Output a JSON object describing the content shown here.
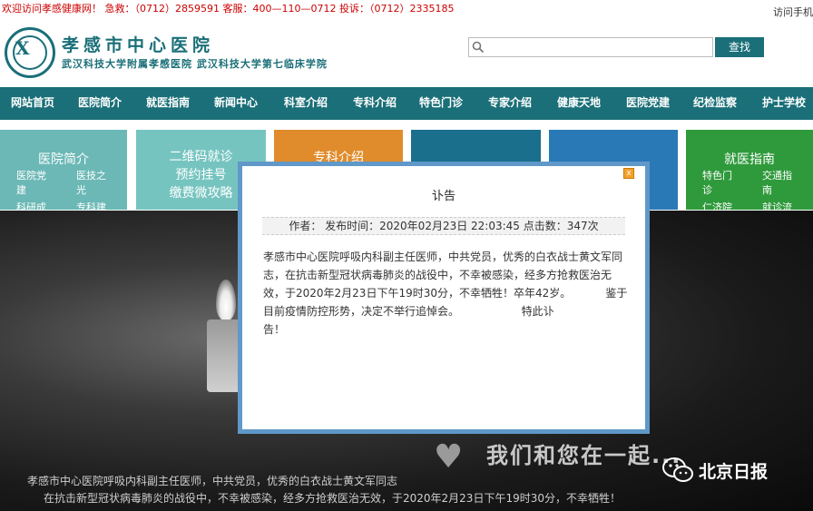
{
  "topbar": {
    "welcome": "欢迎访问孝感健康网！ 急救：（0712）2859591  客服：400—110—0712  投诉：（0712）2335185",
    "mobile": "访问手机"
  },
  "header": {
    "logo_glyph": "X",
    "title": "孝感市中心医院",
    "subtitle": "武汉科技大学附属孝感医院  武汉科技大学第七临床学院",
    "search_placeholder": "",
    "search_button": "查找"
  },
  "nav": [
    "网站首页",
    "医院简介",
    "就医指南",
    "新闻中心",
    "科室介绍",
    "专科介绍",
    "特色门诊",
    "专家介绍",
    "健康天地",
    "医院党建",
    "纪检监察",
    "护士学校"
  ],
  "tiles": {
    "t1": {
      "title": "医院简介",
      "l1": "医院党",
      "l2": "建",
      "r1": "医技之",
      "r2": "光",
      "l3": "科研成",
      "r3": "专科建"
    },
    "t2": {
      "line1": "二维码就诊",
      "line2": "预约挂号",
      "line3": "缴费微攻略"
    },
    "t3": {
      "title": "专科介绍"
    },
    "t6": {
      "title": "就医指南",
      "l1": "特色门",
      "l2": "诊",
      "r1": "交通指",
      "r2": "南",
      "l3": "仁济院",
      "r3": "就诊流"
    }
  },
  "banner": {
    "slogan": "我们和您在一起...",
    "caption1": "孝感市中心医院呼吸内科副主任医师，中共党员，优秀的白衣战士黄文军同志",
    "caption2": "在抗击新型冠状病毒肺炎的战役中，不幸被感染，经多方抢救医治无效，于2020年2月23日下午19时30分，不幸牺牲！",
    "watermark": "北京日报"
  },
  "modal": {
    "title": "讣告",
    "meta": "作者：  发布时间：2020年02月23日 22:03:45  点击数：347次",
    "close": "x",
    "body_lines": [
      "孝感市中心医院呼吸内科副主任医师，中共党员，优秀的白衣战士黄文军同",
      "志，在抗击新型冠状病毒肺炎的战役中，不幸被感染，经多方抢救医治无",
      "效，于2020年2月23日下午19时30分，不幸牺牲！卒年42岁。          鉴于",
      "目前疫情防控形势，决定不举行追悼会。                  特此讣",
      "告！"
    ]
  },
  "colors": {
    "nav": "#1a6f78",
    "tile1": "#6bb8b6",
    "tile2": "#76c4c0",
    "tile3": "#e08c2c",
    "tile4": "#1a6f8c",
    "tile5": "#2a79b7",
    "tile6": "#2f9a3c",
    "modal_border": "#5f98c9"
  }
}
